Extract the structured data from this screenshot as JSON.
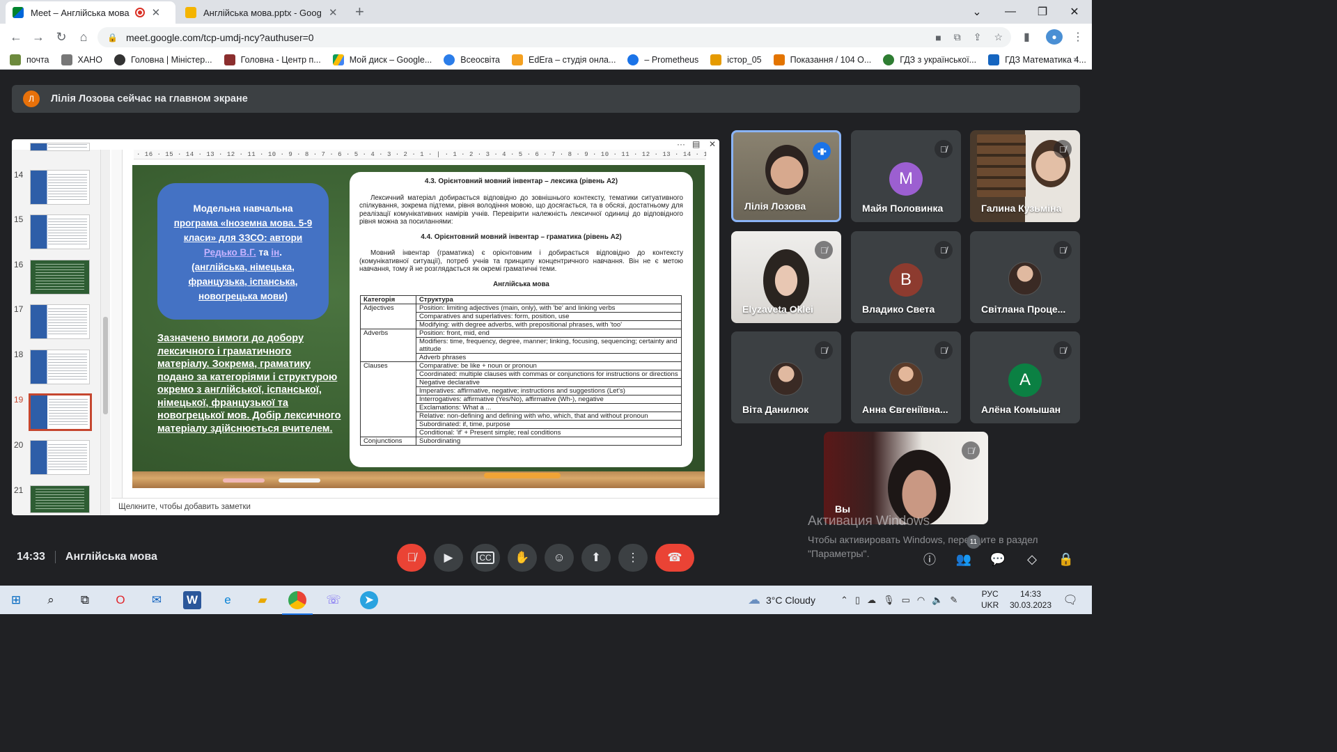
{
  "browser": {
    "tabs": [
      {
        "title": "Meet – Англійська мова",
        "active": true,
        "recording": true
      },
      {
        "title": "Англійська мова.pptx - Google I",
        "active": false
      }
    ],
    "url": "meet.google.com/tcp-umdj-ncy?authuser=0",
    "bookmarks": [
      {
        "label": "почта",
        "color": "#6d8a3d"
      },
      {
        "label": "ХАНО",
        "color": "#777"
      },
      {
        "label": "Головна | Міністер...",
        "color": "#333"
      },
      {
        "label": "Головна - Центр п...",
        "color": "#8b2e2e"
      },
      {
        "label": "Мой диск – Google...",
        "color": "#fbbc04"
      },
      {
        "label": "Всеосвіта",
        "color": "#2b7de9"
      },
      {
        "label": "EdEra – студія онла...",
        "color": "#f4a020"
      },
      {
        "label": "– Prometheus",
        "color": "#1a73e8"
      },
      {
        "label": "істор_05",
        "color": "#e59a00"
      },
      {
        "label": "Показання / 104 О...",
        "color": "#e37400"
      },
      {
        "label": "ГДЗ з української...",
        "color": "#2e7d32"
      },
      {
        "label": "ГДЗ Математика 4...",
        "color": "#1565c0"
      }
    ],
    "more": "»"
  },
  "meet": {
    "banner": {
      "avatar_letter": "Л",
      "text": "Лілія Лозова сейчас на главном экране"
    },
    "presentation": {
      "thumbnails": [
        {
          "num": "14",
          "style": "blue"
        },
        {
          "num": "15",
          "style": "blue"
        },
        {
          "num": "16",
          "style": "green"
        },
        {
          "num": "17",
          "style": "blue"
        },
        {
          "num": "18",
          "style": "blue"
        },
        {
          "num": "19",
          "style": "blue",
          "selected": true
        },
        {
          "num": "20",
          "style": "blue"
        },
        {
          "num": "21",
          "style": "green"
        }
      ],
      "ruler": "· 16 · 15 · 14 · 13 · 12 · 11 · 10 · 9 · 8 · 7 · 6 · 5 · 4 · 3 · 2 · 1 · | · 1 · 2 · 3 · 4 · 5 · 6 · 7 · 8 · 9 · 10 · 11 · 12 · 13 · 14 · 15 · 16 ·",
      "slide": {
        "blue_box": {
          "l1": "Модельна навчальна",
          "l2": "програма «Іноземна мова. 5-9",
          "l3": "класи» для ЗЗСО:",
          "l3b": " автори",
          "l4a": "Редько В.Г.",
          "l4b": " та ",
          "l4c": "ін",
          "l4d": ".",
          "l5": "(англійська, німецька,",
          "l6": "французька, іспанська,",
          "l7": "новогрецька мови)"
        },
        "white_text": "Зазначено вимоги до добору лексичного і граматичного матеріалу. Зокрема, граматику подано за категоріями і структурою окремо з англійської, іспанської, німецької, французької та новогрецької мов. Добір лексичного матеріалу здійснюється вчителем.",
        "doc": {
          "h1": "4.3. Орієнтовний мовний інвентар – лексика (рівень А2)",
          "p1": "Лексичний матеріал добирається відповідно до зовнішнього контексту, тематики ситуативного спілкування, зокрема підтеми, рівня володіння мовою, що досягається, та в обсязі, достатньому для реалізації комунікативних намірів учнів. Перевірити належність лексичної одиниці до відповідного рівня можна за посиланнями:",
          "h2": "4.4. Орієнтовний мовний інвентар – граматика (рівень А2)",
          "p2": "Мовний інвентар (граматика) є орієнтовним і добирається відповідно до контексту (комунікативної ситуації), потреб учнів та принципу концентричного навчання. Він не є метою навчання, тому й не розглядається як окремі граматичні теми.",
          "sub": "Англійська мова",
          "th_cat": "Категорія",
          "th_str": "Структура",
          "rows": [
            {
              "cat": "Adjectives",
              "str": "Position: limiting adjectives (main, only), with 'be' and linking verbs"
            },
            {
              "cat": "",
              "str": "Comparatives and superlatives: form, position, use"
            },
            {
              "cat": "",
              "str": "Modifying: with degree adverbs, with prepositional phrases, with 'too'"
            },
            {
              "cat": "Adverbs",
              "str": "Position: front, mid, end"
            },
            {
              "cat": "",
              "str": "Modifiers: time, frequency, degree, manner; linking, focusing, sequencing; certainty and attitude"
            },
            {
              "cat": "",
              "str": "Adverb phrases"
            },
            {
              "cat": "Clauses",
              "str": "Comparative: be like + noun or pronoun"
            },
            {
              "cat": "",
              "str": "Coordinated: multiple clauses with commas or conjunctions for instructions or directions"
            },
            {
              "cat": "",
              "str": "Negative declarative"
            },
            {
              "cat": "",
              "str": "Imperatives: affirmative, negative; instructions and suggestions (Let's)"
            },
            {
              "cat": "",
              "str": "Interrogatives: affirmative (Yes/No), affirmative (Wh-), negative"
            },
            {
              "cat": "",
              "str": "Exclamations: What a ..."
            },
            {
              "cat": "",
              "str": "Relative: non-defining and defining with who, which, that and without pronoun"
            },
            {
              "cat": "",
              "str": "Subordinated: if, time, purpose"
            },
            {
              "cat": "",
              "str": "Conditional: 'if' + Present simple; real conditions"
            },
            {
              "cat": "Conjunctions",
              "str": "Subordinating"
            }
          ]
        }
      },
      "notes_placeholder": "Щелкните, чтобы добавить заметки"
    },
    "participants": [
      {
        "name": "Лілія Лозова",
        "kind": "video1",
        "speaking": true
      },
      {
        "name": "Майя Половинка",
        "kind": "letter",
        "letter": "M",
        "color": "#9c5fd1"
      },
      {
        "name": "Галина Кузьміна",
        "kind": "video3"
      },
      {
        "name": "Elyzaveta Oklei",
        "kind": "video2"
      },
      {
        "name": "Владико Света",
        "kind": "letter",
        "letter": "B",
        "color": "#8d3b2f"
      },
      {
        "name": "Світлана Проце...",
        "kind": "photo"
      },
      {
        "name": "Віта Данилюк",
        "kind": "photo"
      },
      {
        "name": "Анна Євгеніївна...",
        "kind": "photo"
      },
      {
        "name": "Алёна Комышан",
        "kind": "letter",
        "letter": "A",
        "color": "#0b8043"
      }
    ],
    "self_label": "Вы",
    "activation": {
      "title": "Активация Windows",
      "body": "Чтобы активировать Windows, перейдите в раздел \"Параметры\"."
    },
    "bottom": {
      "time": "14:33",
      "meeting_name": "Англійська мова",
      "people_count": "11"
    }
  },
  "taskbar": {
    "weather": "3°C  Cloudy",
    "lang1": "РУС",
    "lang2": "UKR",
    "time": "14:33",
    "date": "30.03.2023"
  }
}
